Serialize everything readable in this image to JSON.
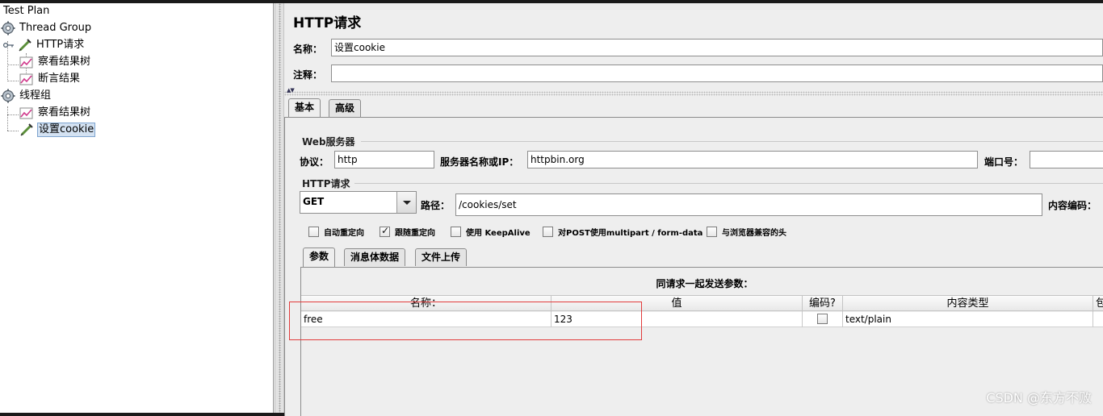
{
  "tree": {
    "test_plan": "Test Plan",
    "thread_group": "Thread Group",
    "http_request": "HTTP请求",
    "view_results_tree_1": "察看结果树",
    "assertion_results": "断言结果",
    "thread_group_cn": "线程组",
    "view_results_tree_2": "察看结果树",
    "set_cookie": "设置cookie"
  },
  "panel": {
    "title": "HTTP请求",
    "name_label": "名称：",
    "name_value": "设置cookie",
    "comment_label": "注释：",
    "comment_value": ""
  },
  "tabs": {
    "basic": "基本",
    "advanced": "高级"
  },
  "web_server": {
    "group_title": "Web服务器",
    "protocol_label": "协议：",
    "protocol_value": "http",
    "server_label": "服务器名称或IP：",
    "server_value": "httpbin.org",
    "port_label": "端口号：",
    "port_value": ""
  },
  "http_request": {
    "group_title": "HTTP请求",
    "method": "GET",
    "path_label": "路径：",
    "path_value": "/cookies/set",
    "encoding_label": "内容编码："
  },
  "options": [
    {
      "label": "自动重定向",
      "checked": false
    },
    {
      "label": "跟随重定向",
      "checked": true
    },
    {
      "label": "使用 KeepAlive",
      "checked": false
    },
    {
      "label": "对POST使用multipart / form-data",
      "checked": false
    },
    {
      "label": "与浏览器兼容的头",
      "checked": false
    }
  ],
  "subtabs": {
    "params": "参数",
    "body": "消息体数据",
    "files": "文件上传"
  },
  "params_table": {
    "caption": "同请求一起发送参数：",
    "headers": [
      "名称：",
      "值",
      "编码?",
      "内容类型",
      "包"
    ],
    "rows": [
      {
        "name": "free",
        "value": "123",
        "encode": false,
        "content_type": "text/plain"
      }
    ]
  },
  "watermark": "CSDN @东方不败",
  "colors": {
    "highlight_box": "#e23b3b",
    "selection": "#d4e2f2"
  }
}
